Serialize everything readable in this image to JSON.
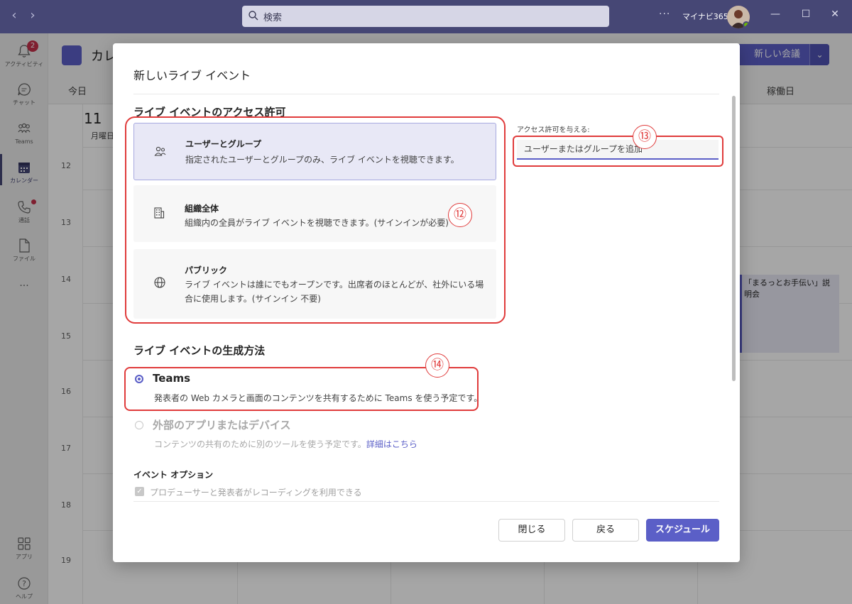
{
  "titlebar": {
    "search_placeholder": "検索",
    "more": "···",
    "org_name": "マイナビ365"
  },
  "rail": {
    "items": [
      {
        "label": "アクティビティ",
        "icon": "bell-icon",
        "badge": "2"
      },
      {
        "label": "チャット",
        "icon": "chat-icon"
      },
      {
        "label": "Teams",
        "icon": "teams-icon"
      },
      {
        "label": "カレンダー",
        "icon": "calendar-icon"
      },
      {
        "label": "通話",
        "icon": "phone-icon"
      },
      {
        "label": "ファイル",
        "icon": "file-icon"
      },
      {
        "label": "···",
        "icon": "more-icon"
      },
      {
        "label": "アプリ",
        "icon": "apps-icon"
      },
      {
        "label": "ヘルプ",
        "icon": "help-icon"
      }
    ]
  },
  "calendar": {
    "title": "カレ",
    "new_meeting": "新しい会議",
    "today": "今日",
    "view": "稼働日",
    "day_number": "11",
    "day_name": "月曜日",
    "hours": [
      "12",
      "13",
      "14",
      "15",
      "16",
      "17",
      "18",
      "19"
    ],
    "event_title": "「まるっとお手伝い」説明会"
  },
  "dialog": {
    "title": "新しいライブ イベント",
    "access_section": "ライブ イベントのアクセス許可",
    "options": [
      {
        "title": "ユーザーとグループ",
        "desc": "指定されたユーザーとグループのみ、ライブ イベントを視聴できます。",
        "icon": "people-icon"
      },
      {
        "title": "組織全体",
        "desc": "組織内の全員がライブ イベントを視聴できます。(サインインが必要)",
        "icon": "building-icon"
      },
      {
        "title": "パブリック",
        "desc": "ライブ イベントは誰にでもオープンです。出席者のほとんどが、社外にいる場合に使用します。(サインイン 不要)",
        "icon": "globe-icon"
      }
    ],
    "grant_label": "アクセス許可を与える:",
    "grant_placeholder": "ユーザーまたはグループを追加",
    "production_section": "ライブ イベントの生成方法",
    "production": [
      {
        "title": "Teams",
        "desc": "発表者の Web カメラと画面のコンテンツを共有するために Teams を使う予定です。",
        "selected": true
      },
      {
        "title": "外部のアプリまたはデバイス",
        "desc": "コンテンツの共有のために別のツールを使う予定です。",
        "link": "詳細はこちら",
        "selected": false
      }
    ],
    "event_options_heading": "イベント オプション",
    "recording_option": "プロデューサーと発表者がレコーディングを利用できる",
    "buttons": {
      "close": "閉じる",
      "back": "戻る",
      "schedule": "スケジュール"
    }
  },
  "annotations": [
    "⑫",
    "⑬",
    "⑭"
  ],
  "colors": {
    "brand": "#464775",
    "accent": "#5b5fc7",
    "annotation": "#e03b3b"
  }
}
